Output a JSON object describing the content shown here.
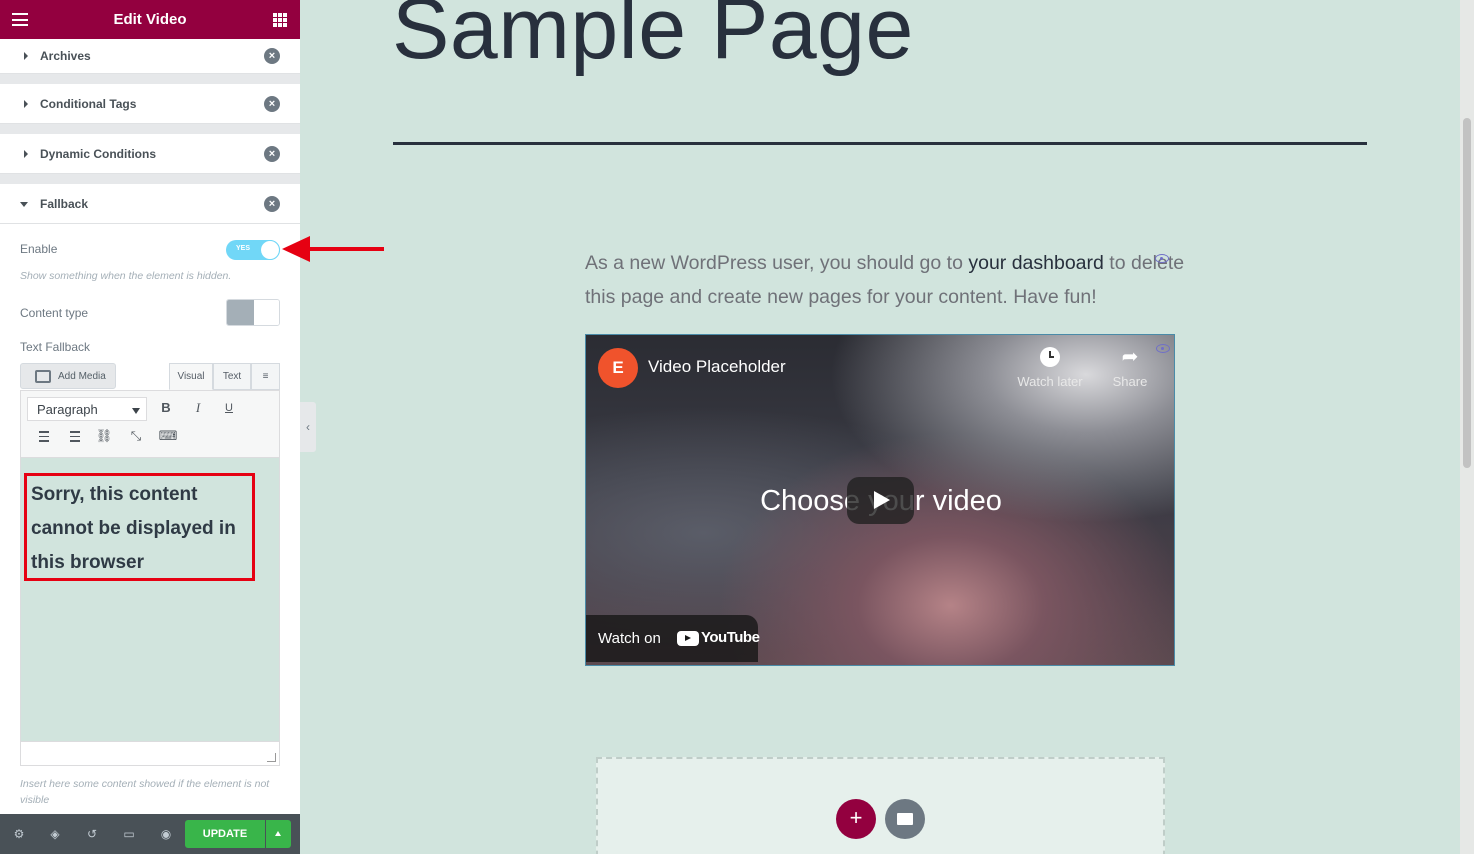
{
  "panel": {
    "title": "Edit Video",
    "sections": [
      {
        "label": "Archives"
      },
      {
        "label": "Conditional Tags"
      },
      {
        "label": "Dynamic Conditions"
      },
      {
        "label": "Fallback"
      }
    ],
    "fallback": {
      "enable_label": "Enable",
      "enable_toggle_text": "YES",
      "enable_on": true,
      "enable_desc": "Show something when the element is hidden.",
      "content_type_label": "Content type",
      "text_fallback_label": "Text Fallback",
      "add_media": "Add Media",
      "tab_visual": "Visual",
      "tab_text": "Text",
      "format_select": "Paragraph",
      "bold": "B",
      "italic": "I",
      "underline": "U",
      "editor_content": "Sorry, this content cannot be displayed in this browser",
      "footer_desc": "Insert here some content showed if the element is not visible"
    },
    "footer": {
      "update_label": "UPDATE"
    }
  },
  "preview": {
    "page_title": "Sample Page",
    "intro_before": "As a new WordPress user, you should go to ",
    "intro_link": "your dashboard",
    "intro_after": " to delete this page and create new pages for your content. Have fun!",
    "video": {
      "channel_initial": "E",
      "title": "Video Placeholder",
      "watch_later": "Watch later",
      "share": "Share",
      "center_text": "Choose your video",
      "watch_on": "Watch on",
      "youtube": "YouTube"
    },
    "add_section": "+"
  },
  "colors": {
    "brand": "#93003f",
    "page_bg": "#d1e4dd",
    "update_green": "#39b54a",
    "annotation_red": "#e60012",
    "toggle_on": "#71d7f7"
  }
}
